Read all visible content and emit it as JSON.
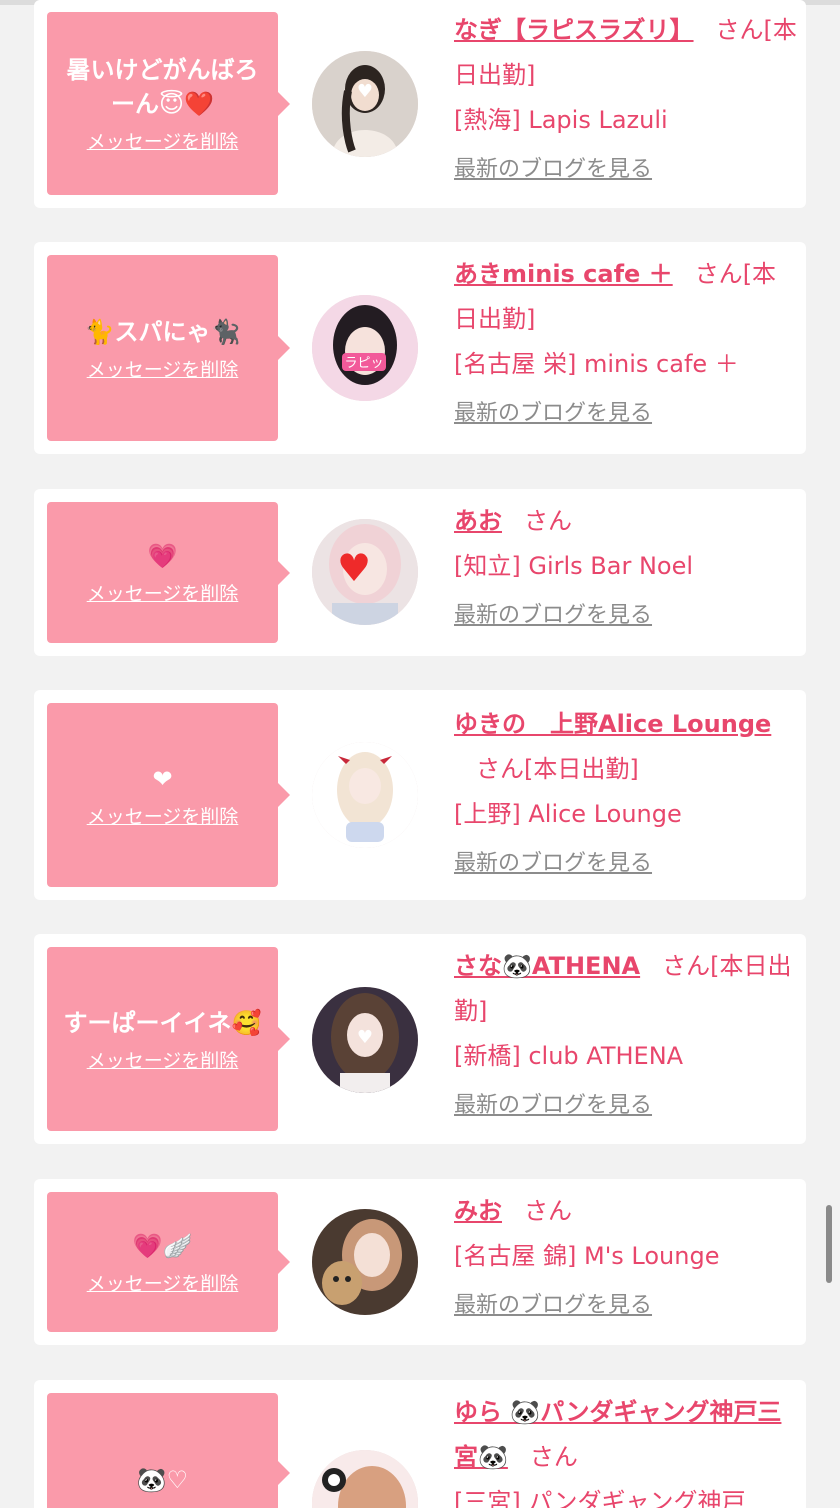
{
  "common": {
    "delete_label": "メッセージを削除",
    "blog_label": "最新のブログを見る",
    "san": "さん"
  },
  "cards": [
    {
      "message": "暑いけどがんばろーん😇❤️",
      "name": "なぎ【ラピスラズリ】",
      "tail": "[本日出勤]",
      "shop": "[熱海] Lapis Lazuli"
    },
    {
      "message": "🐈スパにゃ🐈‍⬛",
      "name": "あきminis cafe ＋",
      "tail": "[本日出勤]",
      "shop": "[名古屋 栄] minis cafe ＋"
    },
    {
      "message": "💗",
      "name": "あお",
      "tail": "",
      "shop": "[知立] Girls Bar Noel"
    },
    {
      "message": "❤",
      "name": "ゆきの　上野Alice Lounge",
      "tail": "[本日出勤]",
      "shop": "[上野] Alice Lounge"
    },
    {
      "message": "すーぱーイイネ🥰",
      "name": "さな🐼ATHENA",
      "tail": "[本日出勤]",
      "shop": "[新橋] club ATHENA"
    },
    {
      "message": "💗🪽",
      "name": "みお",
      "tail": "",
      "shop": "[名古屋 錦] M's Lounge"
    },
    {
      "message": "🐼♡",
      "name": "ゆら 🐼パンダギャング神戸三宮🐼",
      "tail": "",
      "shop": "[三宮] パンダギャング神戸"
    }
  ],
  "colors": {
    "accent": "#e8466c",
    "bubble": "#fa9aaa",
    "background": "#f2f2f2"
  }
}
